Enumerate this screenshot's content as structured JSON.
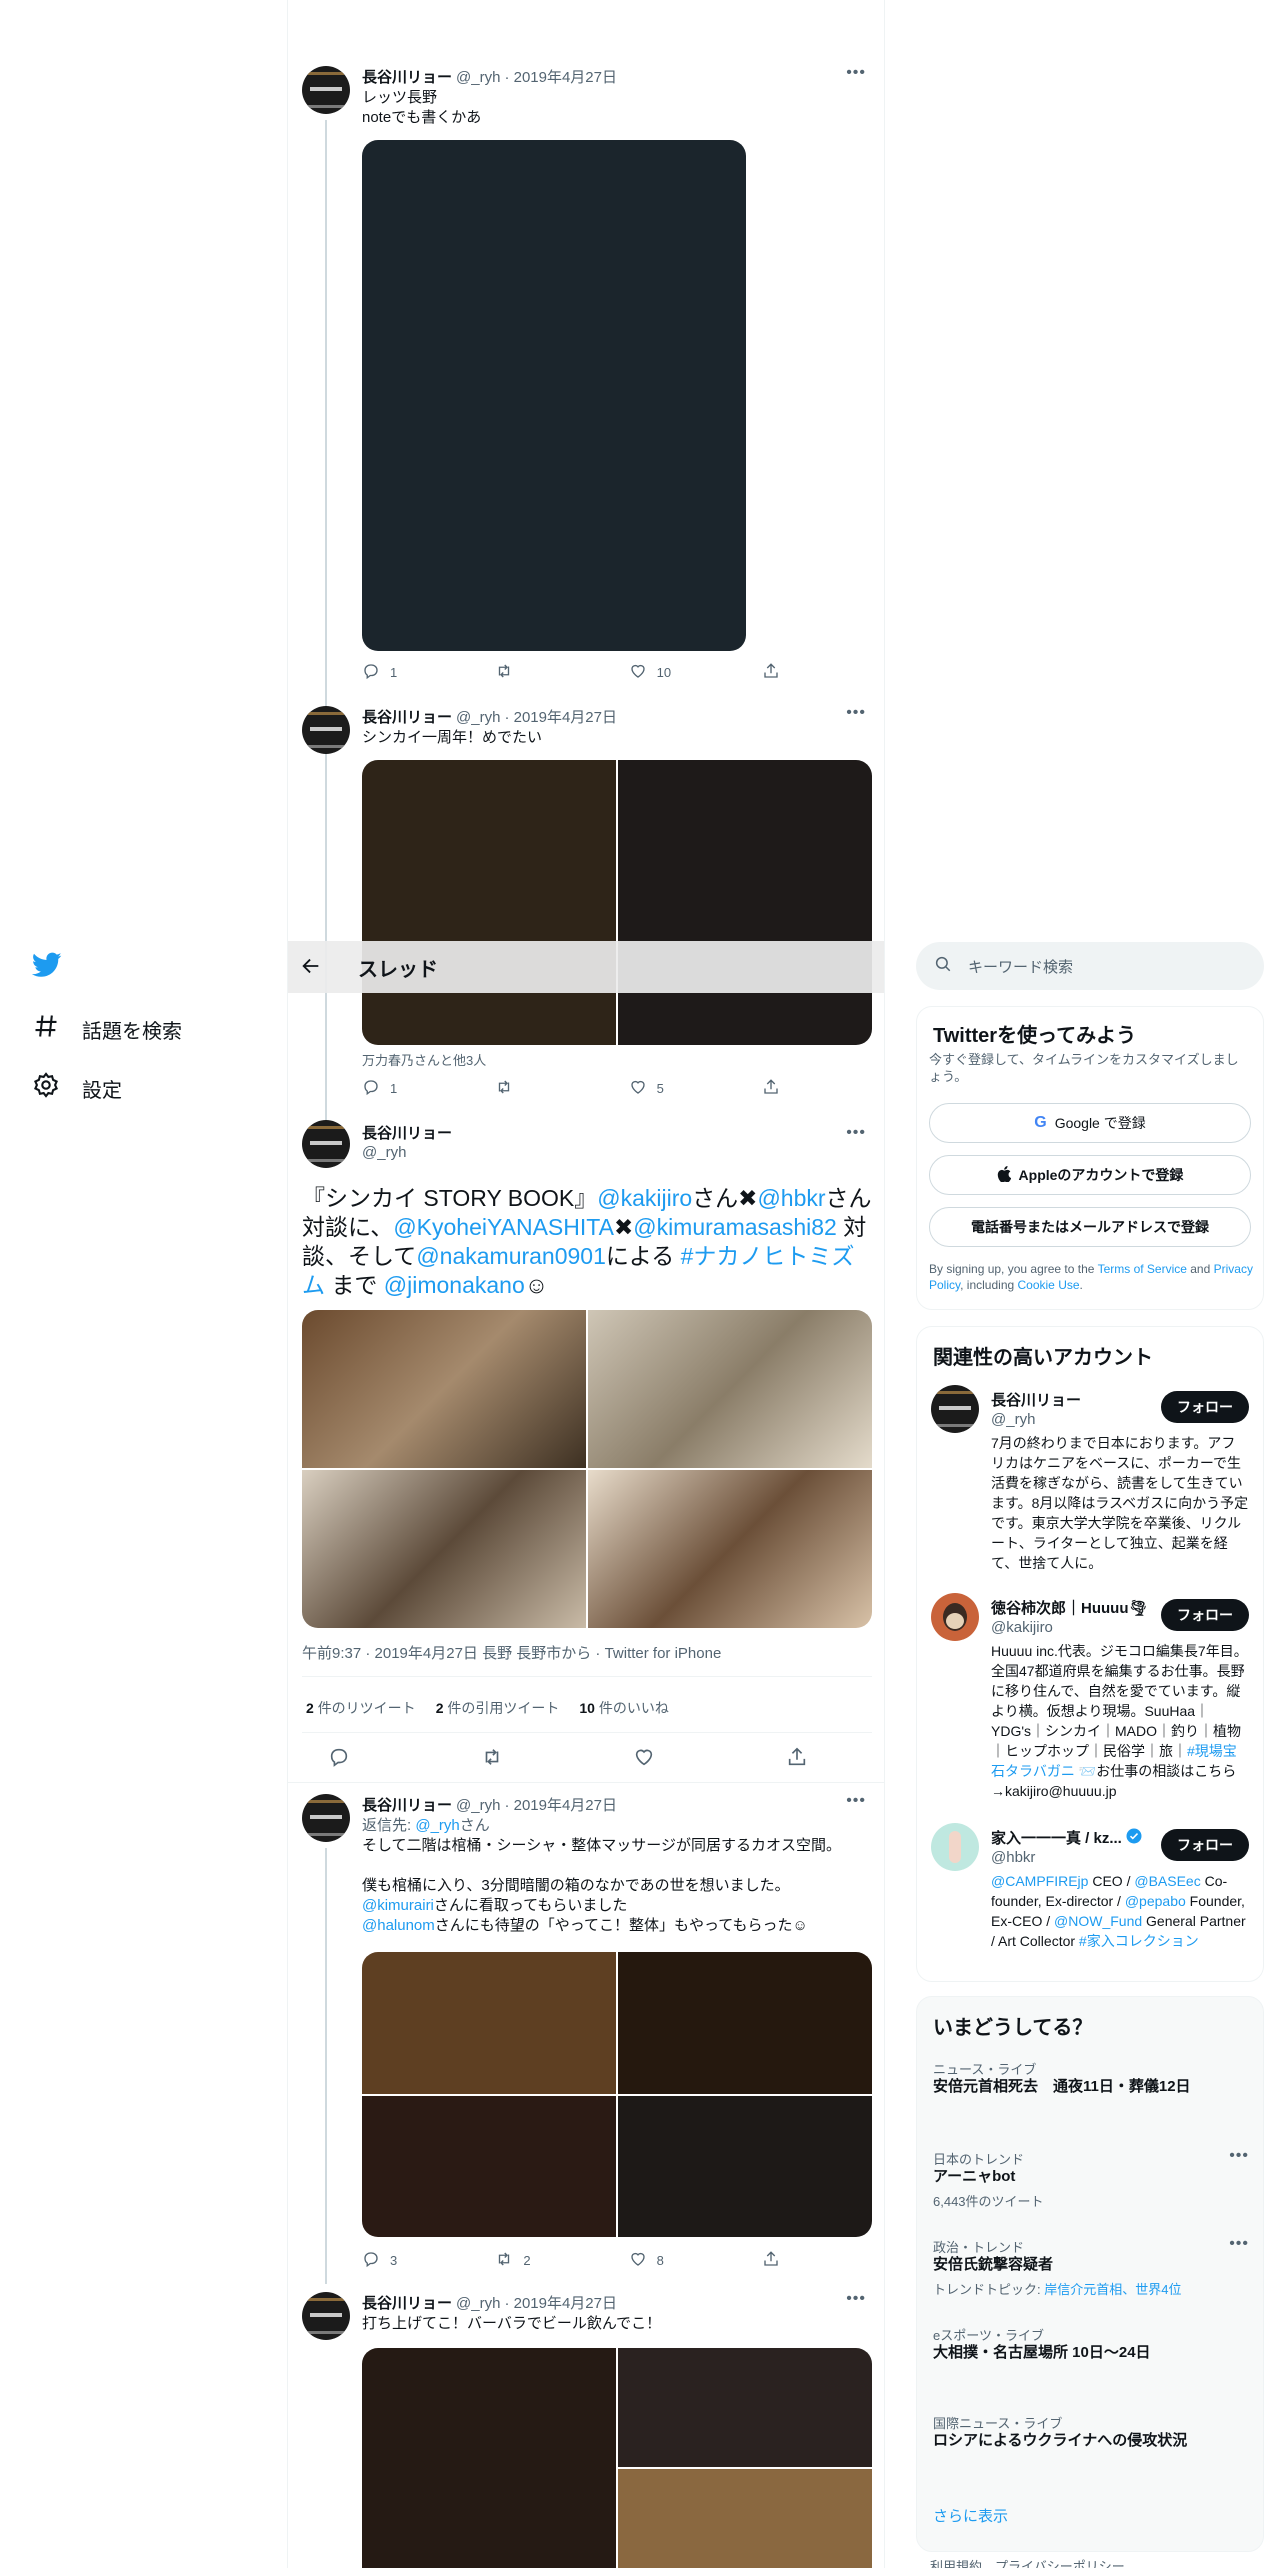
{
  "nav": {
    "explore_label": "話題を検索",
    "settings_label": "設定"
  },
  "header": {
    "title": "スレッド"
  },
  "tweets": [
    {
      "name": "長谷川リョー",
      "handle": "@_ryh",
      "date": "· 2019年4月27日",
      "lines": [
        "レッツ長野",
        "noteでも書くかあ"
      ],
      "replies": "1",
      "retweets": "",
      "likes": "10"
    },
    {
      "name": "長谷川リョー",
      "handle": "@_ryh",
      "date": "· 2019年4月27日",
      "lines": [
        "シンカイ一周年！めでたい"
      ],
      "media_caption": "万力春乃さんと他3人",
      "replies": "1",
      "retweets": "",
      "likes": "5"
    },
    {
      "name": "長谷川リョー",
      "handle": "@_ryh",
      "time_line": "午前9:37 · 2019年4月27日 長野 長野市から · Twitter for iPhone",
      "retweet_count": "2",
      "retweet_label": "件のリツイート",
      "quote_count": "2",
      "quote_label": "件の引用ツイート",
      "like_count": "10",
      "like_label": "件のいいね",
      "text": {
        "t1": "『シンカイ STORY BOOK』",
        "m1": "@kakijiro",
        "t2": "さん✖",
        "m2": "@hbkr",
        "t3": "さん対談に、",
        "m3": "@KyoheiYANASHITA",
        "t4": "✖",
        "m4": "@kimuramasashi82",
        "t5": " 対談、そして",
        "m5": "@nakamuran0901",
        "t6": "による ",
        "m6": "#ナカノヒトミズム",
        "t7": " まで ",
        "m7": "@jimonakano",
        "t8": "☺"
      }
    },
    {
      "name": "長谷川リョー",
      "handle": "@_ryh",
      "date": "· 2019年4月27日",
      "reply_to_label": "返信先: ",
      "reply_to_handle": "@_ryh",
      "reply_to_suffix": "さん",
      "line1": "そして二階は棺桶・シーシャ・整体マッサージが同居するカオス空間。",
      "line2": "僕も棺桶に入り、3分間暗闇の箱のなかであの世を想いました。",
      "m1": "@kimurairi",
      "line3": "さんに看取ってもらいました",
      "m2": "@halunom",
      "line4": "さんにも待望の「やってこ！整体」もやってもらった☺",
      "replies": "3",
      "retweets": "2",
      "likes": "8"
    },
    {
      "name": "長谷川リョー",
      "handle": "@_ryh",
      "date": "· 2019年4月27日",
      "lines": [
        "打ち上げてこ！バーバラでビール飲んでこ！"
      ]
    }
  ],
  "search": {
    "placeholder": "キーワード検索"
  },
  "signup": {
    "title": "Twitterを使ってみよう",
    "subtitle": "今すぐ登録して、タイムラインをカスタマイズしましょう。",
    "google": "Google で登録",
    "apple": "Appleのアカウントで登録",
    "phone": "電話番号またはメールアドレスで登録",
    "terms_prefix": "By signing up, you agree to the ",
    "terms_link": "Terms of Service",
    "terms_mid": " and ",
    "privacy_link": "Privacy Policy",
    "terms_mid2": ", including ",
    "cookie_link": "Cookie Use",
    "terms_end": "."
  },
  "related": {
    "title": "関連性の高いアカウント",
    "follow_label": "フォロー",
    "accounts": [
      {
        "name": "長谷川リョー",
        "handle": "@_ryh",
        "bio": "7月の終わりまで日本におります。アフリカはケニアをベースに、ポーカーで生活費を稼ぎながら、読書をして生きています。8月以降はラスベガスに向かう予定です。東京大学大学院を卒業後、リクルート、ライターとして独立、起業を経て、世捨て人に。"
      },
      {
        "name": "徳谷柿次郎｜Huuuu🌪",
        "handle": "@kakijiro",
        "bio": "Huuuu inc.代表。ジモコロ編集長7年目。全国47都道府県を編集するお仕事。長野に移り住んで、自然を愛でています。縦より横。仮想より現場。SuuHaa｜YDG's｜シンカイ｜MADO｜釣り｜植物｜ヒップホップ｜民俗学｜旅｜",
        "bio_link": "#現場宝石タラバガニ",
        "bio_end": " 📨お仕事の相談はこちら→kakijiro@huuuu.jp"
      },
      {
        "name": "家入一一一真 / kz...",
        "handle": "@hbkr",
        "b1": "@CAMPFIREjp",
        "b2": " CEO / ",
        "b3": "@BASEec",
        "b4": " Co-founder, Ex-director / ",
        "b5": "@pepabo",
        "b6": " Founder, Ex-CEO / ",
        "b7": "@NOW_Fund",
        "b8": " General Partner / Art Collector ",
        "b9": "#家入コレクション"
      }
    ]
  },
  "trends": {
    "title": "いまどうしてる？",
    "items": [
      {
        "category": "ニュース・ライブ",
        "title": "安倍元首相死去　通夜11日・葬儀12日",
        "meta": ""
      },
      {
        "category": "日本のトレンド",
        "title": "アーニャbot",
        "meta": "6,443件のツイート"
      },
      {
        "category": "政治・トレンド",
        "title": "安倍氏銃撃容疑者",
        "meta": "トレンドトピック: ",
        "meta_link": "岸信介元首相、世界4位"
      },
      {
        "category": "eスポーツ・ライブ",
        "title": "大相撲・名古屋場所 10日〜24日",
        "meta": ""
      },
      {
        "category": "国際ニュース・ライブ",
        "title": "ロシアによるウクライナへの侵攻状況",
        "meta": ""
      }
    ],
    "show_more": "さらに表示"
  },
  "footer": {
    "links": "利用規約　プライバシーポリシー"
  },
  "colors": {
    "accent": "#1d9bf0",
    "text": "#0f1419",
    "muted": "#536471"
  }
}
